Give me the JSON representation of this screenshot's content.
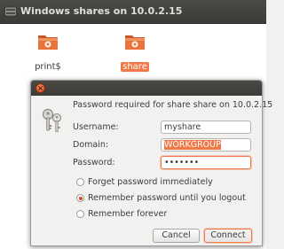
{
  "window": {
    "title": "Windows shares on 10.0.2.15"
  },
  "files": [
    {
      "label": "print$",
      "icon": "folder-icon",
      "selected": false
    },
    {
      "label": "share",
      "icon": "folder-icon",
      "selected": true
    }
  ],
  "dialog": {
    "prompt": "Password required for share share on 10.0.2.15",
    "username_label": "Username:",
    "username_value": "myshare",
    "domain_label": "Domain:",
    "domain_value": "WORKGROUP",
    "password_label": "Password:",
    "password_value": "•••••••",
    "options": [
      {
        "label": "Forget password immediately",
        "checked": false
      },
      {
        "label": "Remember password until you logout",
        "checked": true
      },
      {
        "label": "Remember forever",
        "checked": false
      }
    ],
    "cancel_label": "Cancel",
    "connect_label": "Connect"
  },
  "colors": {
    "accent": "#f07746",
    "titlebar": "#3c3b37",
    "folder": "#e8743a"
  }
}
